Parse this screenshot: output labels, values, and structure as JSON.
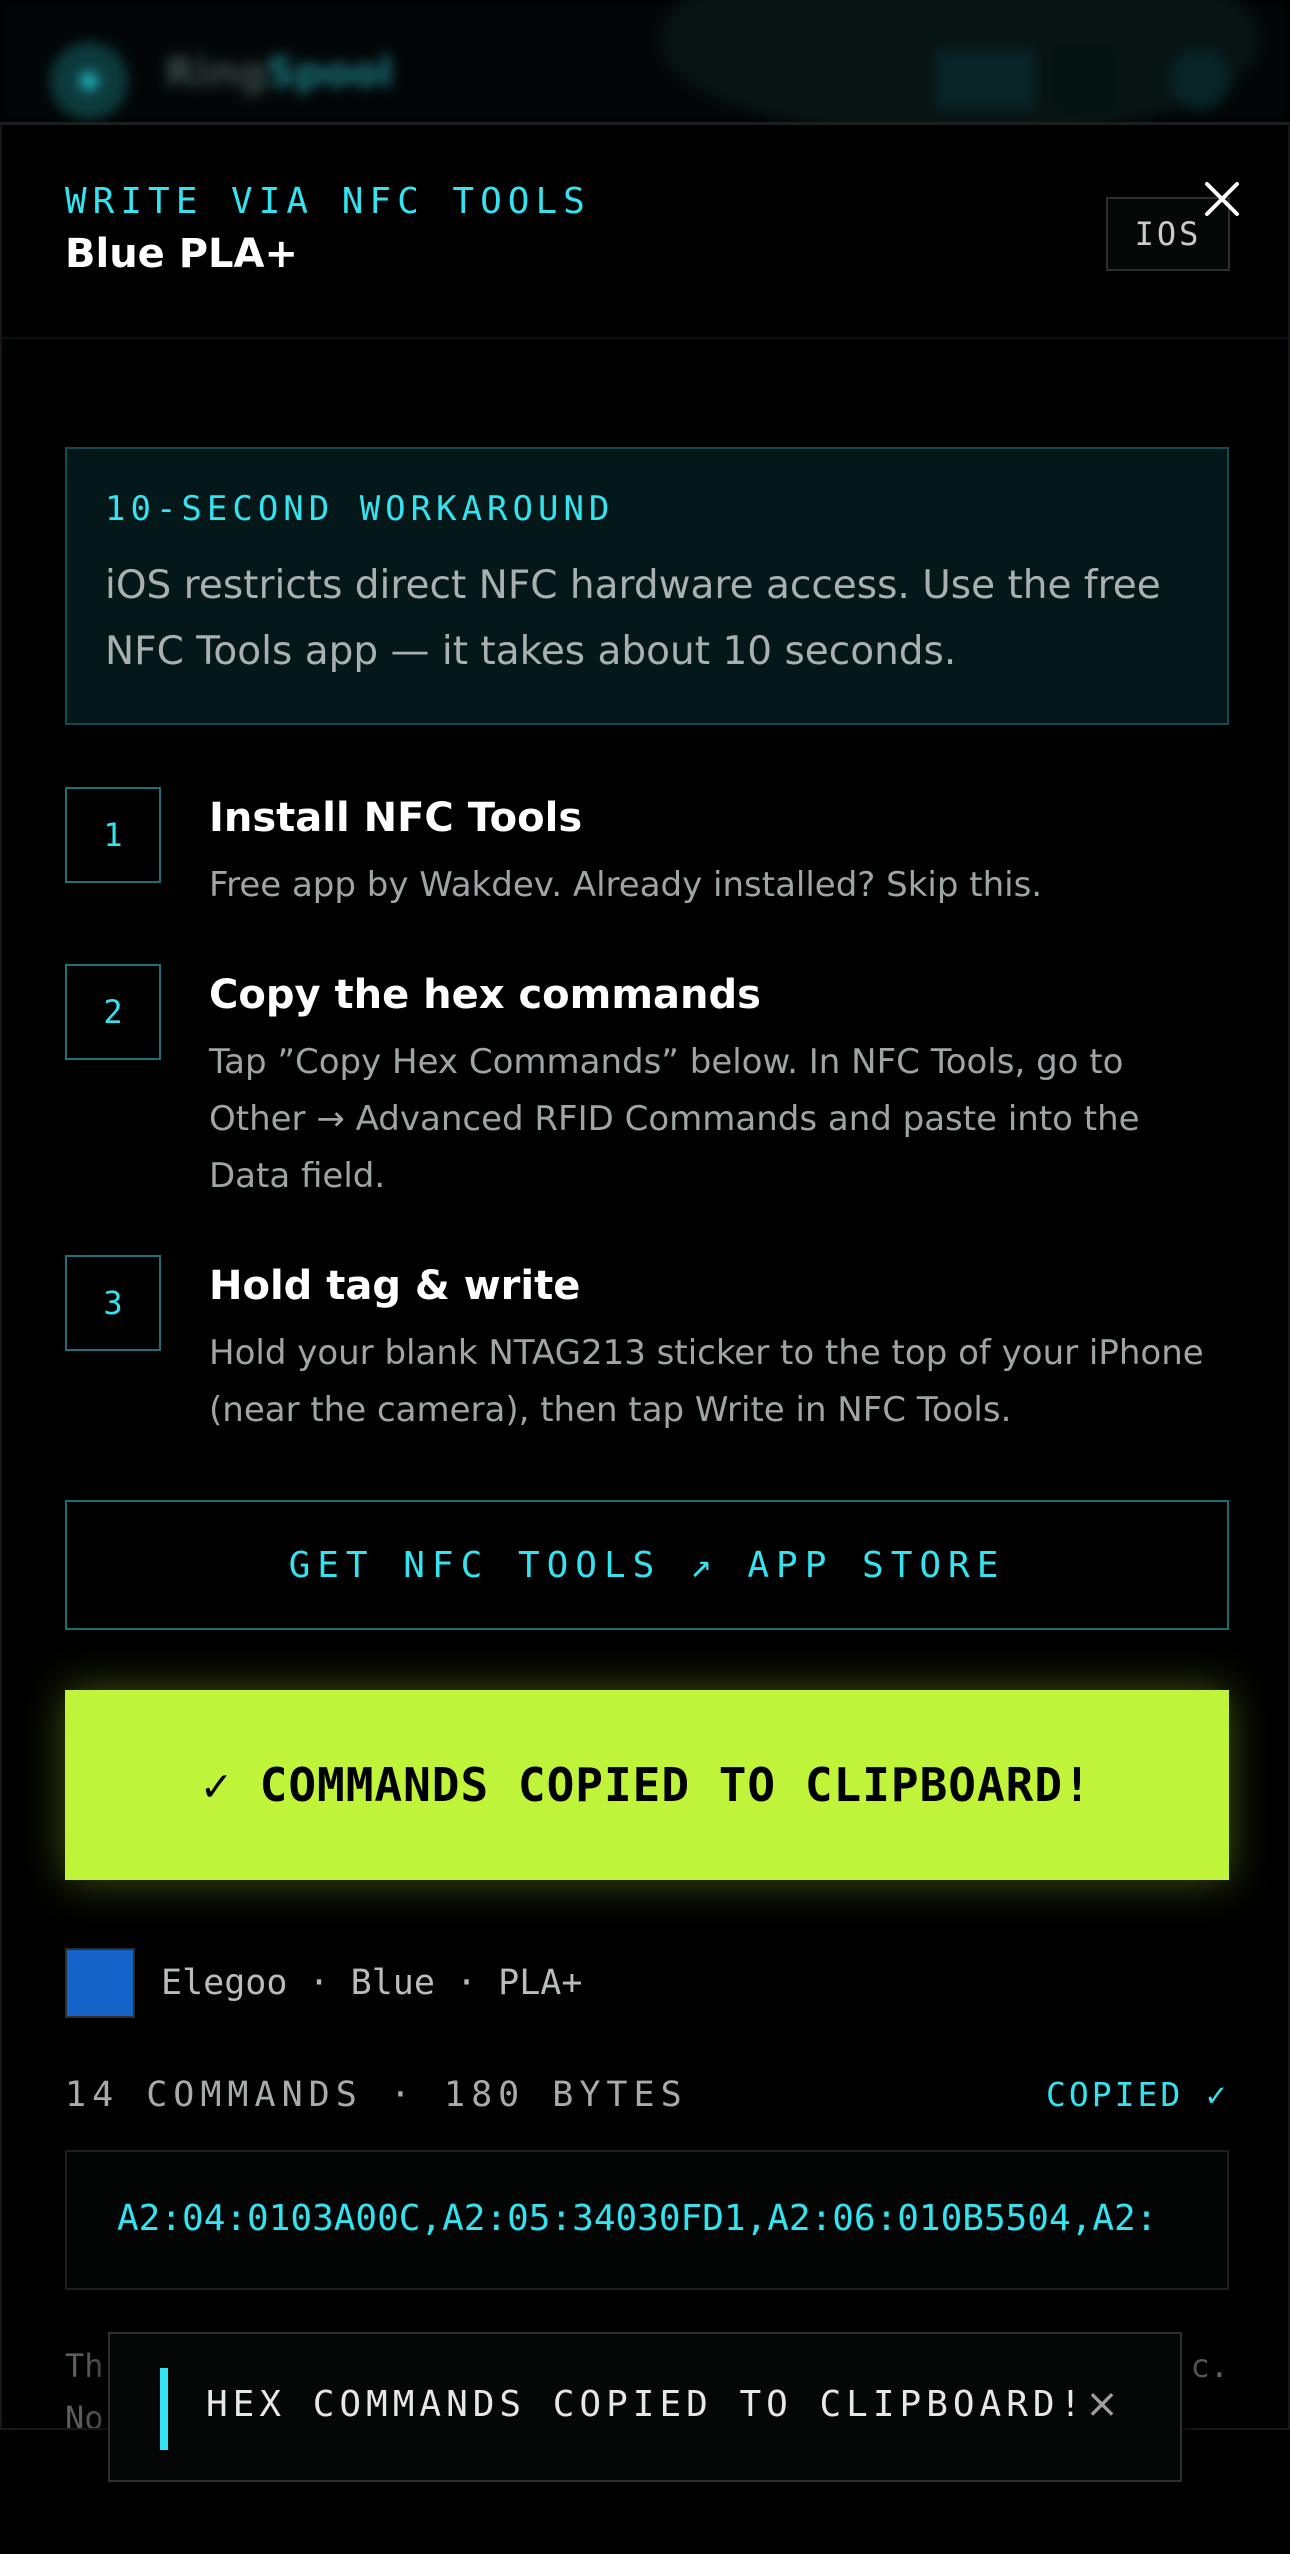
{
  "app_header": {
    "name_prefix": "Ring",
    "name_highlight": "Spool"
  },
  "sheet": {
    "eyebrow": "WRITE VIA NFC TOOLS",
    "title": "Blue PLA+",
    "platform_badge": "IOS",
    "close_icon": "close-icon"
  },
  "info": {
    "eyebrow": "10-SECOND WORKAROUND",
    "text": "iOS restricts direct NFC hardware access. Use the free NFC Tools app — it takes about 10 seconds."
  },
  "steps": [
    {
      "number": "1",
      "title": "Install NFC Tools",
      "text": "Free app by Wakdev. Already installed? Skip this."
    },
    {
      "number": "2",
      "title": "Copy the hex commands",
      "text": "Tap ”Copy Hex Commands” below. In NFC Tools, go to Other → Advanced RFID Commands and paste into the Data field."
    },
    {
      "number": "3",
      "title": "Hold tag & write",
      "text": "Hold your blank NTAG213 sticker to the top of your iPhone (near the camera), then tap Write in NFC Tools."
    }
  ],
  "store_button": "GET NFC TOOLS ↗ APP STORE",
  "copied_button": "✓ COMMANDS COPIED TO CLIPBOARD!",
  "filament": {
    "label": "Elegoo · Blue · PLA+",
    "swatch_color": "#1563c8"
  },
  "commands": {
    "summary": "14 COMMANDS · 180 BYTES",
    "status": "COPIED ✓",
    "hex": "A2:04:0103A00C,A2:05:34030FD1,A2:06:010B5504,A2:"
  },
  "footer": {
    "line1": "Th",
    "line1_end": "c.",
    "line2": "No"
  },
  "toast": {
    "text": "HEX COMMANDS COPIED TO CLIPBOARD!",
    "close_glyph": "×"
  },
  "colors": {
    "accent": "#33e3f0",
    "success": "#c0f43a",
    "background": "#000000"
  }
}
